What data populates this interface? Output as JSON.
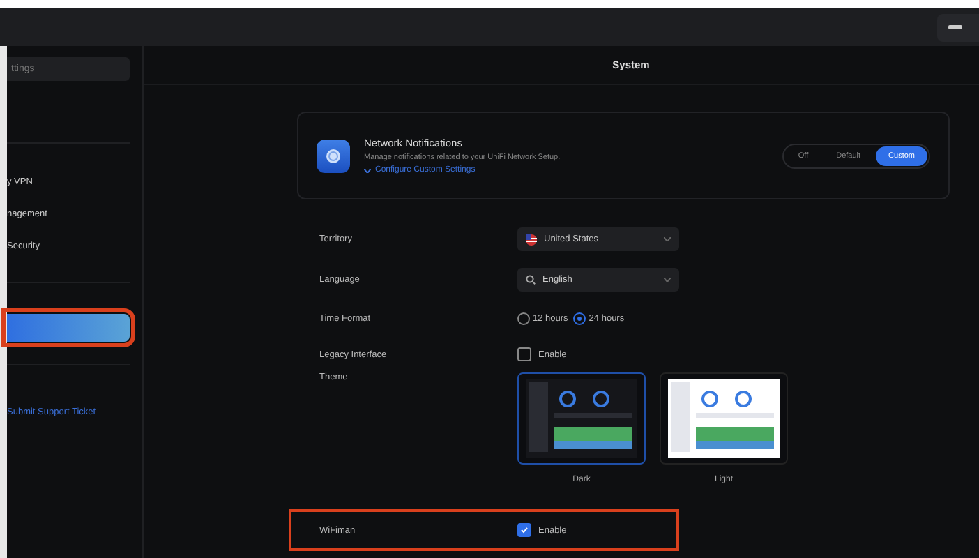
{
  "sidebar": {
    "search": {
      "placeholder": "ttings"
    },
    "items": [
      {
        "label": "y VPN",
        "selected": false
      },
      {
        "label": "nagement",
        "selected": false
      },
      {
        "label": "Security",
        "selected": false
      },
      {
        "selected": true
      }
    ],
    "support_link": "Submit Support Ticket"
  },
  "page_title": "System",
  "notifications": {
    "title": "Network Notifications",
    "description": "Manage notifications related to your UniFi Network Setup.",
    "link": "Configure Custom Settings",
    "modes": [
      {
        "label": "Off",
        "selected": false
      },
      {
        "label": "Default",
        "selected": false
      },
      {
        "label": "Custom",
        "selected": true
      }
    ]
  },
  "settings": [
    {
      "kind": "select",
      "label": "Territory",
      "value": "United States"
    },
    {
      "kind": "select",
      "label": "Language",
      "value": "English"
    },
    {
      "kind": "radio",
      "label": "Time Format",
      "options": [
        {
          "label": "12 hours",
          "selected": false
        },
        {
          "label": "24 hours",
          "selected": true
        }
      ]
    },
    {
      "kind": "checkbox",
      "label": "Legacy Interface",
      "option": "Enable",
      "checked": false,
      "highlighted": false
    },
    {
      "kind": "theme",
      "label": "Theme",
      "options": [
        {
          "label": "Dark",
          "selected": true
        },
        {
          "label": "Light",
          "selected": false
        }
      ]
    },
    {
      "kind": "checkbox",
      "label": "WiFiman",
      "option": "Enable",
      "checked": true,
      "highlighted": true
    }
  ]
}
